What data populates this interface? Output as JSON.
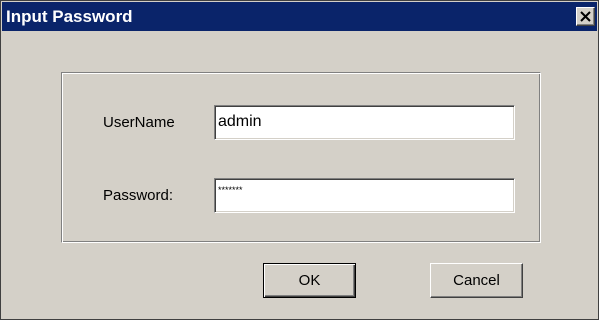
{
  "window": {
    "title": "Input Password",
    "close_icon": "close-icon",
    "colors": {
      "titlebar": "#0a246a",
      "face": "#d4d0c8"
    }
  },
  "form": {
    "username_label": "UserName",
    "username_value": "admin",
    "password_label": "Password:",
    "password_mask": "*******"
  },
  "buttons": {
    "ok_label": "OK",
    "cancel_label": "Cancel"
  }
}
